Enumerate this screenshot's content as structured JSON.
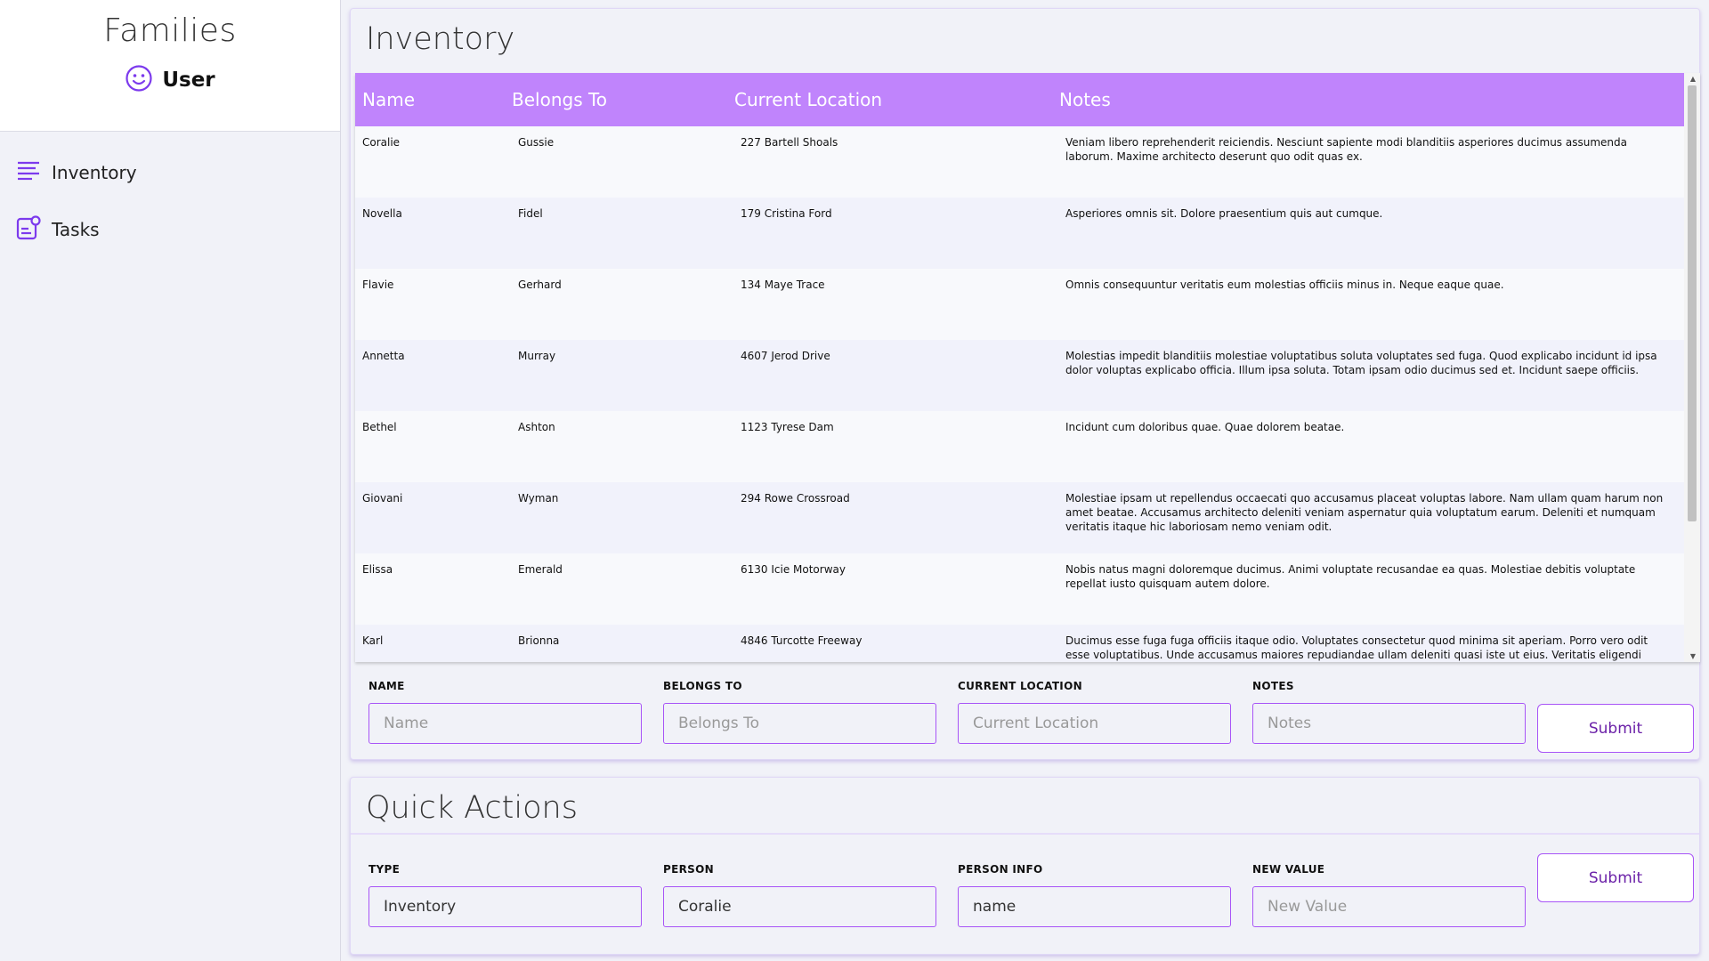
{
  "app": {
    "title": "Families",
    "user_name": "User"
  },
  "nav": {
    "items": [
      {
        "label": "Inventory",
        "icon": "list-lines-icon"
      },
      {
        "label": "Tasks",
        "icon": "clipboard-user-icon"
      }
    ]
  },
  "inventory": {
    "title": "Inventory",
    "columns": [
      "Name",
      "Belongs To",
      "Current Location",
      "Notes"
    ],
    "rows": [
      [
        "Coralie",
        "Gussie",
        "227 Bartell Shoals",
        "Veniam libero reprehenderit reiciendis. Nesciunt sapiente modi blanditiis asperiores ducimus assumenda laborum. Maxime architecto deserunt quo odit quas ex."
      ],
      [
        "Novella",
        "Fidel",
        "179 Cristina Ford",
        "Asperiores omnis sit. Dolore praesentium quis aut cumque."
      ],
      [
        "Flavie",
        "Gerhard",
        "134 Maye Trace",
        "Omnis consequuntur veritatis eum molestias officiis minus in. Neque eaque quae."
      ],
      [
        "Annetta",
        "Murray",
        "4607 Jerod Drive",
        "Molestias impedit blanditiis molestiae voluptatibus soluta voluptates sed fuga. Quod explicabo incidunt id ipsa dolor voluptas explicabo officia. Illum ipsa soluta. Totam ipsam odio ducimus sed et. Incidunt saepe officiis."
      ],
      [
        "Bethel",
        "Ashton",
        "1123 Tyrese Dam",
        "Incidunt cum doloribus quae. Quae dolorem beatae."
      ],
      [
        "Giovani",
        "Wyman",
        "294 Rowe Crossroad",
        "Molestiae ipsam ut repellendus occaecati quo accusamus placeat voluptas labore. Nam ullam quam harum non amet beatae. Accusamus architecto deleniti veniam aspernatur quia voluptatum earum. Deleniti et numquam veritatis itaque hic laboriosam nemo veniam odit."
      ],
      [
        "Elissa",
        "Emerald",
        "6130 Icie Motorway",
        "Nobis natus magni doloremque ducimus. Animi voluptate recusandae ea quas. Molestiae debitis voluptate repellat iusto quisquam autem dolore."
      ],
      [
        "Karl",
        "Brionna",
        "4846 Turcotte Freeway",
        "Ducimus esse fuga fuga officiis itaque odio. Voluptates consectetur quod minima sit aperiam. Porro vero odit esse voluptatibus. Unde accusamus maiores repudiandae ullam deleniti quasi iste ut eius. Veritatis eligendi rerum."
      ]
    ],
    "form": {
      "fields": [
        {
          "label": "Name",
          "placeholder": "Name",
          "value": ""
        },
        {
          "label": "Belongs To",
          "placeholder": "Belongs To",
          "value": ""
        },
        {
          "label": "Current Location",
          "placeholder": "Current Location",
          "value": ""
        },
        {
          "label": "Notes",
          "placeholder": "Notes",
          "value": ""
        }
      ],
      "submit_label": "Submit"
    }
  },
  "quick_actions": {
    "title": "Quick Actions",
    "fields": [
      {
        "label": "Type",
        "placeholder": "Type",
        "value": "Inventory"
      },
      {
        "label": "Person",
        "placeholder": "Person",
        "value": "Coralie"
      },
      {
        "label": "Person Info",
        "placeholder": "Person Info",
        "value": "name"
      },
      {
        "label": "New Value",
        "placeholder": "New Value",
        "value": ""
      }
    ],
    "submit_label": "Submit"
  },
  "colors": {
    "accent": "#a855f7",
    "table_header": "#c084fc",
    "icon": "#7c3aed"
  }
}
